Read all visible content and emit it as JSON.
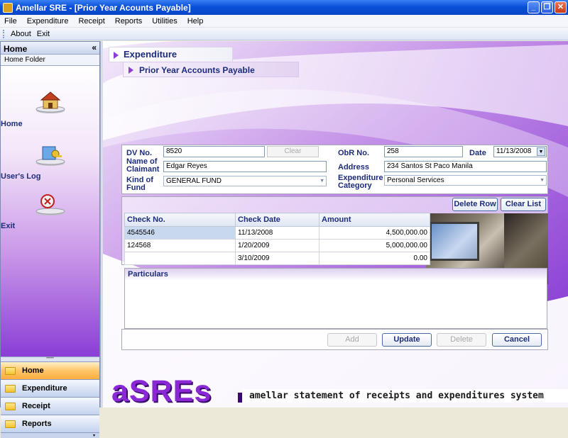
{
  "window": {
    "title": "Amellar SRE - [Prior Year Acounts Payable]"
  },
  "menu": [
    "File",
    "Expenditure",
    "Receipt",
    "Reports",
    "Utilities",
    "Help"
  ],
  "toolbar": [
    "About",
    "Exit"
  ],
  "sidebar": {
    "header": "Home",
    "collapse": "«",
    "subheader": "Home Folder",
    "items": [
      {
        "label": "Home",
        "icon": "house-icon"
      },
      {
        "label": "User's Log",
        "icon": "user-log-icon"
      },
      {
        "label": "Exit",
        "icon": "exit-icon"
      }
    ],
    "nav": [
      {
        "label": "Home",
        "active": true
      },
      {
        "label": "Expenditure",
        "active": false
      },
      {
        "label": "Receipt",
        "active": false
      },
      {
        "label": "Reports",
        "active": false
      }
    ]
  },
  "header": {
    "section": "Expenditure",
    "subsection": "Prior Year Accounts Payable"
  },
  "form": {
    "dv_no_label": "DV No.",
    "dv_no": "8520",
    "clear_label": "Clear",
    "obr_no_label": "ObR No.",
    "obr_no": "258",
    "date_label": "Date",
    "date": "11/13/2008",
    "claimant_label": "Name of Claimant",
    "claimant": "Edgar Reyes",
    "address_label": "Address",
    "address": "234 Santos St Paco Manila",
    "fund_label": "Kind of Fund",
    "fund": "GENERAL FUND",
    "category_label": "Expenditure Category",
    "category": "Personal Services"
  },
  "grid": {
    "delete_row": "Delete Row",
    "clear_list": "Clear List",
    "columns": [
      "Check No.",
      "Check Date",
      "Amount"
    ],
    "rows": [
      [
        "4545546",
        "11/13/2008",
        "4,500,000.00"
      ],
      [
        "124568",
        "1/20/2009",
        "5,000,000.00"
      ],
      [
        "",
        "3/10/2009",
        "0.00"
      ]
    ]
  },
  "particulars": {
    "label": "Particulars"
  },
  "actions": {
    "add": "Add",
    "update": "Update",
    "delete": "Delete",
    "cancel": "Cancel"
  },
  "brand": {
    "logo": "aSREs",
    "tagline": "amellar statement of receipts and expenditures system"
  },
  "colors": {
    "accent": "#8a3ed6",
    "label": "#1c2c7a",
    "titlebar": "#0a50d8"
  }
}
